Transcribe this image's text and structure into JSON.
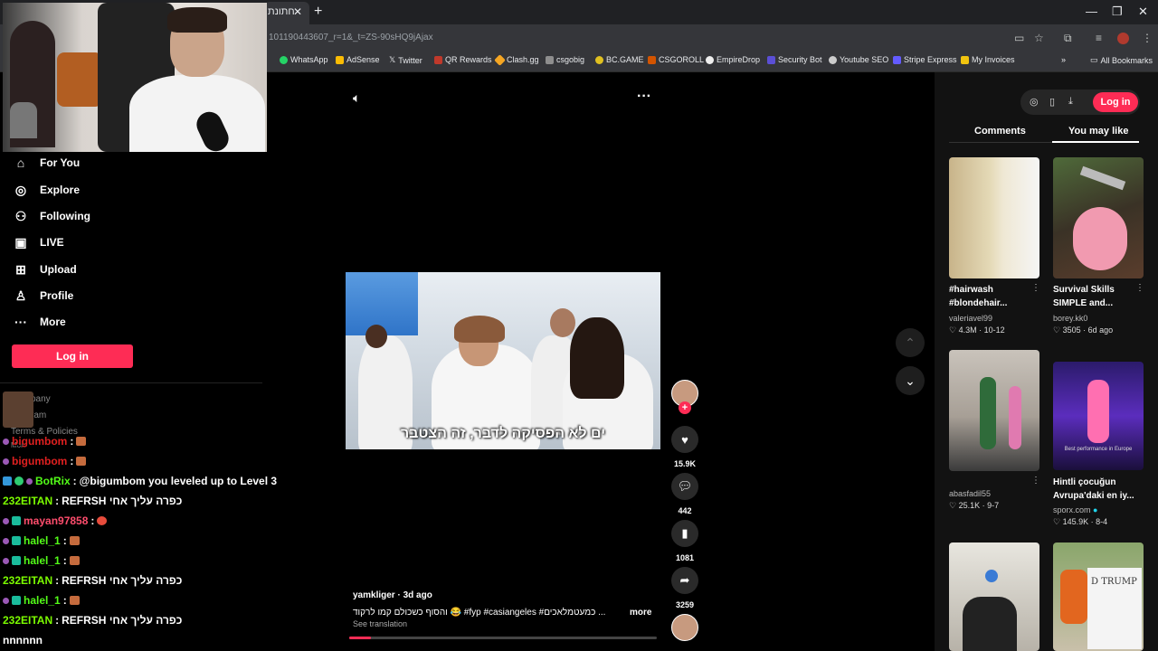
{
  "browser": {
    "tab_title": "חתונת",
    "url": "101190443607_r=1&_t=ZS-90sHQ9jAjax",
    "bookmarks": [
      "WhatsApp",
      "AdSense",
      "Twitter",
      "QR Rewards",
      "Clash.gg",
      "csgobig",
      "BC.GAME",
      "CSGOROLL",
      "EmpireDrop",
      "Security Bot",
      "Youtube SEO",
      "Stripe Express",
      "My Invoices"
    ],
    "all_bookmarks": "All Bookmarks"
  },
  "nav": {
    "items": [
      "For You",
      "Explore",
      "Following",
      "LIVE",
      "Upload",
      "Profile",
      "More"
    ],
    "login": "Log in",
    "faded": [
      "pany",
      "ram",
      "Terms & Policies",
      "More"
    ]
  },
  "chat": [
    {
      "user": "bigumbom",
      "sep": " :",
      "msg": "",
      "color": "#e02020",
      "emote": true
    },
    {
      "user": "bigumbom",
      "sep": " :",
      "msg": "",
      "color": "#e02020",
      "emote": true
    },
    {
      "user": "BotRix",
      "sep": " :",
      "msg": " @bigumbom you leveled up to Level 3",
      "color": "#53fc18",
      "emote": false
    },
    {
      "user": "232EITAN",
      "sep": " :",
      "msg": " REFRSH כפרה עליך אחי",
      "color": "#7cfc00",
      "emote": false
    },
    {
      "user": "mayan97858",
      "sep": " :",
      "msg": "",
      "color": "#ff4d6d",
      "emote": true
    },
    {
      "user": "halel_1",
      "sep": " :",
      "msg": "",
      "color": "#53fc18",
      "emote": true
    },
    {
      "user": "halel_1",
      "sep": " :",
      "msg": "",
      "color": "#53fc18",
      "emote": true
    },
    {
      "user": "232EITAN",
      "sep": " :",
      "msg": " REFRSH כפרה עליך אחי",
      "color": "#7cfc00",
      "emote": false
    },
    {
      "user": "halel_1",
      "sep": " :",
      "msg": "",
      "color": "#53fc18",
      "emote": true
    },
    {
      "user": "232EITAN",
      "sep": " :",
      "msg": " REFRSH כפרה עליך אחי",
      "color": "#7cfc00",
      "emote": false
    },
    {
      "user": "",
      "sep": "",
      "msg": "nnnnnn",
      "color": "#ffffff",
      "emote": false
    }
  ],
  "video": {
    "subtitle": "ים לא הפסיקה לדבר, זה הצטבר",
    "author": "yamkliger · 3d ago",
    "caption": "והסוף כשכולם קמו לרקוד 😂 #fyp  #casiangeles  #כמעטמלאכים  ...",
    "more": "more",
    "see_translation": "See translation",
    "progress": 0.07,
    "stats": {
      "likes": "15.9K",
      "comments": "442",
      "saves": "1081",
      "shares": "3259"
    }
  },
  "right_panel": {
    "login": "Log in",
    "tabs": [
      "Comments",
      "You may like"
    ],
    "cards": [
      {
        "title": "#hairwash #blondehair...",
        "author": "valeriavel99",
        "stats": "♡ 4.3M · 10-12"
      },
      {
        "title": "Survival Skills SIMPLE and...",
        "author": "borey.kk0",
        "stats": "♡ 3505 · 6d ago"
      },
      {
        "title": "",
        "author": "abasfadil55",
        "stats": "♡ 25.1K · 9-7"
      },
      {
        "title": "Hintli çocuğun Avrupa'daki en iy...",
        "author": "sporx.com",
        "stats": "♡ 145.9K · 8-4"
      }
    ],
    "thumb_caption": "Best performance in Europe",
    "sign_text": "D TRUMP"
  }
}
